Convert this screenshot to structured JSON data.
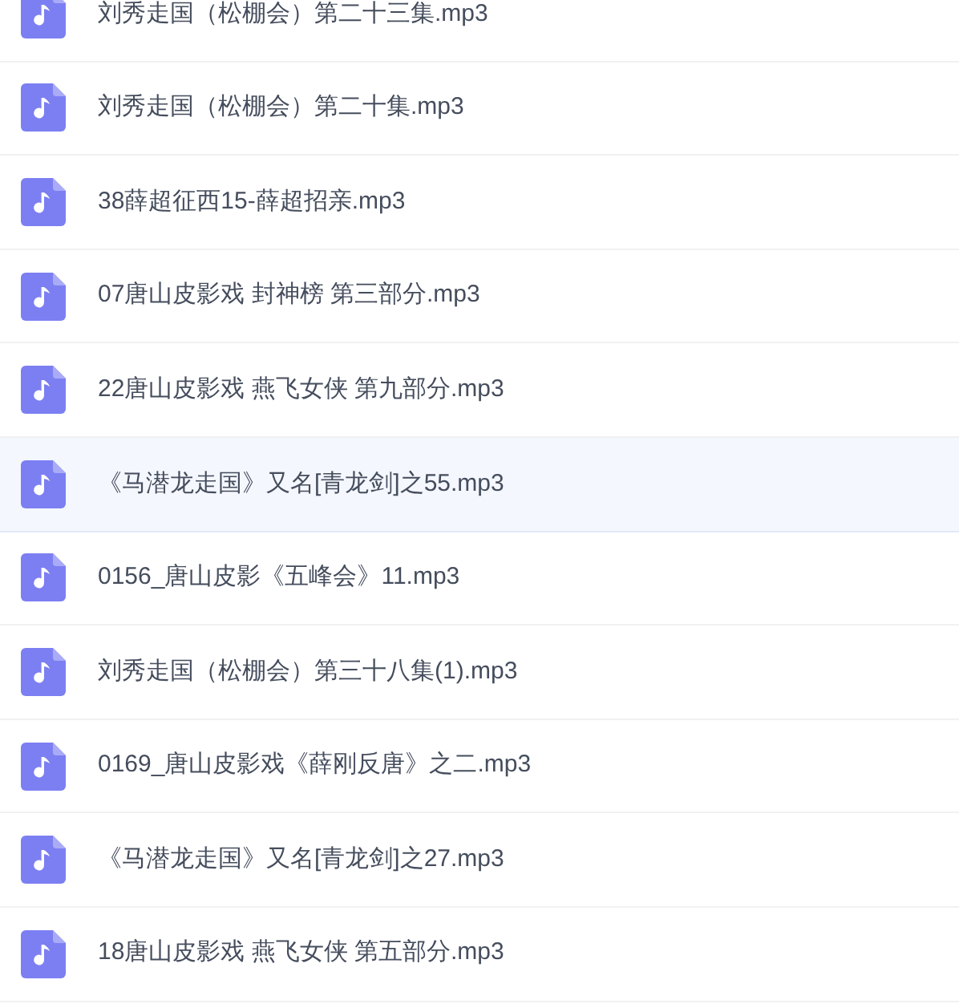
{
  "files": [
    {
      "name": "刘秀走国（松棚会）第二十三集.mp3",
      "selected": false
    },
    {
      "name": "刘秀走国（松棚会）第二十集.mp3",
      "selected": false
    },
    {
      "name": "38薛超征西15-薛超招亲.mp3",
      "selected": false
    },
    {
      "name": "07唐山皮影戏 封神榜 第三部分.mp3",
      "selected": false
    },
    {
      "name": "22唐山皮影戏 燕飞女侠 第九部分.mp3",
      "selected": false
    },
    {
      "name": "《马潜龙走国》又名[青龙剑]之55.mp3",
      "selected": true
    },
    {
      "name": "0156_唐山皮影《五峰会》11.mp3",
      "selected": false
    },
    {
      "name": "刘秀走国（松棚会）第三十八集(1).mp3",
      "selected": false
    },
    {
      "name": "0169_唐山皮影戏《薛刚反唐》之二.mp3",
      "selected": false
    },
    {
      "name": "《马潜龙走国》又名[青龙剑]之27.mp3",
      "selected": false
    },
    {
      "name": "18唐山皮影戏 燕飞女侠 第五部分.mp3",
      "selected": false
    }
  ]
}
